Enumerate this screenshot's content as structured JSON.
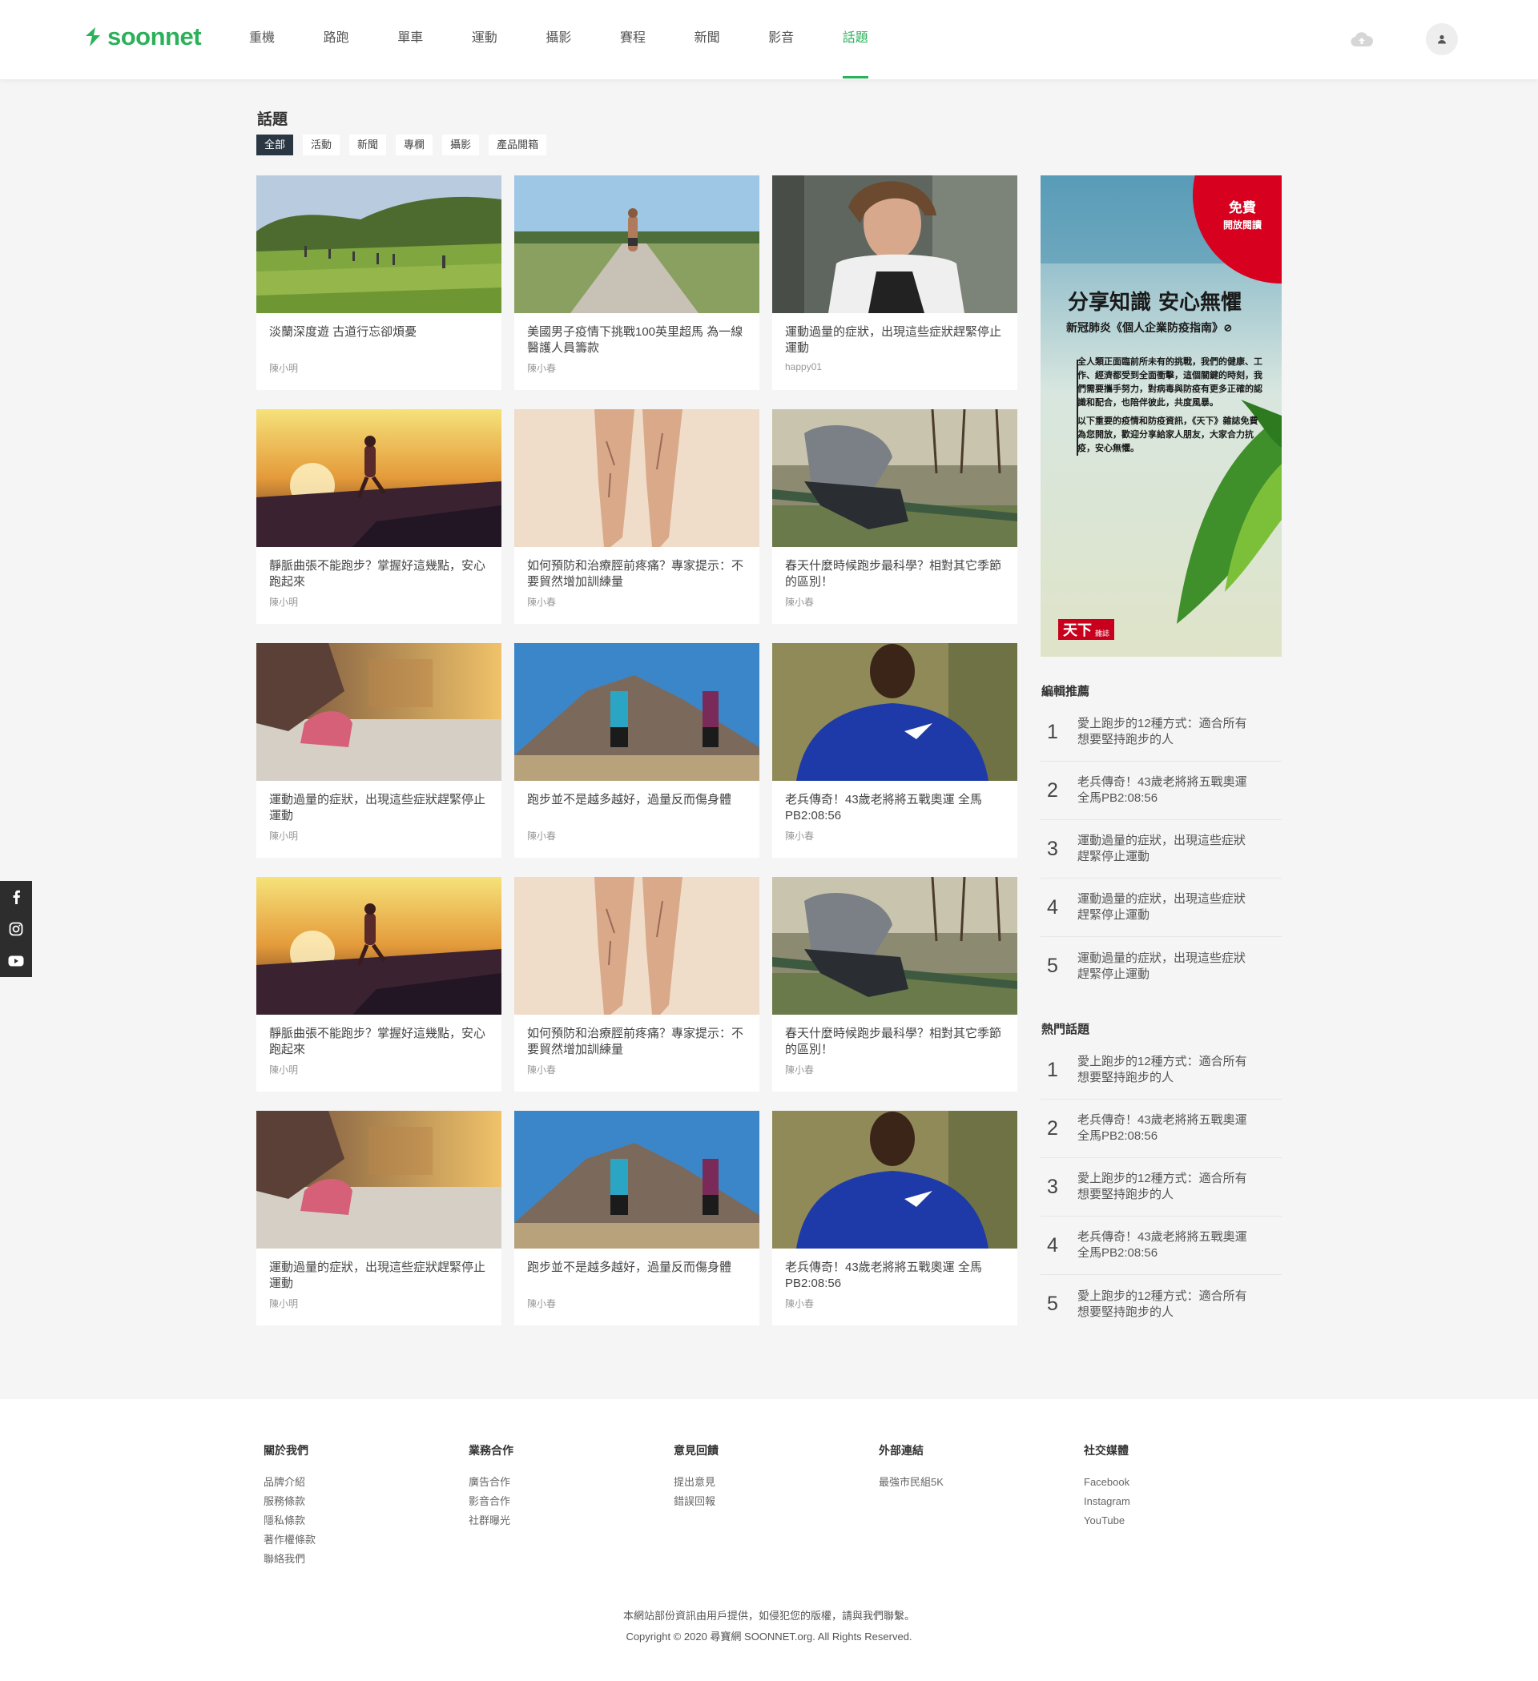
{
  "brand": {
    "name": "soonnet",
    "color": "#2bb15a"
  },
  "nav": {
    "items": [
      {
        "label": "重機"
      },
      {
        "label": "路跑"
      },
      {
        "label": "單車"
      },
      {
        "label": "運動"
      },
      {
        "label": "攝影"
      },
      {
        "label": "賽程"
      },
      {
        "label": "新聞"
      },
      {
        "label": "影音"
      },
      {
        "label": "話題"
      }
    ],
    "active_index": 8,
    "icons": [
      "cloud-icon",
      "user-icon"
    ]
  },
  "social_bar": {
    "icons": [
      "facebook-icon",
      "instagram-icon",
      "youtube-icon"
    ]
  },
  "page": {
    "title": "話題",
    "filters": [
      "全部",
      "活動",
      "新聞",
      "專欄",
      "攝影",
      "產品開箱"
    ],
    "active_filter": 0
  },
  "articles": [
    {
      "title": "淡蘭深度遊 古道行忘卻煩憂",
      "author": "陳小明"
    },
    {
      "title": "美國男子疫情下挑戰100英里超馬 為一線醫護人員籌款",
      "author": "陳小春"
    },
    {
      "title": "運動過量的症狀，出現這些症狀趕緊停止運動",
      "author": "happy01"
    },
    {
      "title": "靜脈曲張不能跑步？掌握好這幾點，安心跑起來",
      "author": "陳小明"
    },
    {
      "title": "如何預防和治療脛前疼痛？專家提示：不要貿然增加訓練量",
      "author": "陳小春"
    },
    {
      "title": "春天什麼時候跑步最科學？相對其它季節的區別！",
      "author": "陳小春"
    },
    {
      "title": "運動過量的症狀，出現這些症狀趕緊停止運動",
      "author": "陳小明"
    },
    {
      "title": "跑步並不是越多越好，過量反而傷身體",
      "author": "陳小春"
    },
    {
      "title": "老兵傳奇！43歲老將將五戰奧運 全馬PB2:08:56",
      "author": "陳小春"
    },
    {
      "title": "靜脈曲張不能跑步？掌握好這幾點，安心跑起來",
      "author": "陳小明"
    },
    {
      "title": "如何預防和治療脛前疼痛？專家提示：不要貿然增加訓練量",
      "author": "陳小春"
    },
    {
      "title": "春天什麼時候跑步最科學？相對其它季節的區別！",
      "author": "陳小春"
    },
    {
      "title": "運動過量的症狀，出現這些症狀趕緊停止運動",
      "author": "陳小明"
    },
    {
      "title": "跑步並不是越多越好，過量反而傷身體",
      "author": "陳小春"
    },
    {
      "title": "老兵傳奇！43歲老將將五戰奧運 全馬PB2:08:56",
      "author": "陳小春"
    }
  ],
  "ad": {
    "badge_line1": "免費",
    "badge_line2": "開放閱讀",
    "headline": "分享知識 安心無懼",
    "subhead": "新冠肺炎《個人企業防疫指南》⊘",
    "body1": "全人類正面臨前所未有的挑戰，我們的健康、工作、經濟都受到全面衝擊，這個關鍵的時刻，我們需要攜手努力，對病毒與防疫有更多正確的認識和配合，也陪伴彼此，共度風暴。",
    "body2": "以下重要的疫情和防疫資訊，《天下》雜誌免費為您開放，歡迎分享給家人朋友，大家合力抗疫，安心無懼。",
    "logo_text": "天下",
    "logo_sub": "雜誌"
  },
  "editor_picks": {
    "title": "編輯推薦",
    "items": [
      {
        "num": "1",
        "text": "愛上跑步的12種方式：適合所有想要堅持跑步的人"
      },
      {
        "num": "2",
        "text": "老兵傳奇！43歲老將將五戰奧運 全馬PB2:08:56"
      },
      {
        "num": "3",
        "text": "運動過量的症狀，出現這些症狀趕緊停止運動"
      },
      {
        "num": "4",
        "text": "運動過量的症狀，出現這些症狀趕緊停止運動"
      },
      {
        "num": "5",
        "text": "運動過量的症狀，出現這些症狀趕緊停止運動"
      }
    ]
  },
  "hot_topics": {
    "title": "熱門話題",
    "items": [
      {
        "num": "1",
        "text": "愛上跑步的12種方式：適合所有想要堅持跑步的人"
      },
      {
        "num": "2",
        "text": "老兵傳奇！43歲老將將五戰奧運 全馬PB2:08:56"
      },
      {
        "num": "3",
        "text": "愛上跑步的12種方式：適合所有想要堅持跑步的人"
      },
      {
        "num": "4",
        "text": "老兵傳奇！43歲老將將五戰奧運 全馬PB2:08:56"
      },
      {
        "num": "5",
        "text": "愛上跑步的12種方式：適合所有想要堅持跑步的人"
      }
    ]
  },
  "footer": {
    "columns": [
      {
        "title": "關於我們",
        "links": [
          "品牌介紹",
          "服務條款",
          "隱私條款",
          "著作權條款",
          "聯絡我們"
        ]
      },
      {
        "title": "業務合作",
        "links": [
          "廣告合作",
          "影音合作",
          "社群曝光"
        ]
      },
      {
        "title": "意見回饋",
        "links": [
          "提出意見",
          "錯誤回報"
        ]
      },
      {
        "title": "外部連結",
        "links": [
          "最強市民組5K"
        ]
      },
      {
        "title": "社交媒體",
        "links": [
          "Facebook",
          "Instagram",
          "YouTube"
        ]
      }
    ],
    "notice": "本網站部份資訊由用戶提供，如侵犯您的版權，請與我們聯繫。",
    "copyright": "Copyright © 2020 尋寶網 SOONNET.org. All Rights Reserved."
  }
}
